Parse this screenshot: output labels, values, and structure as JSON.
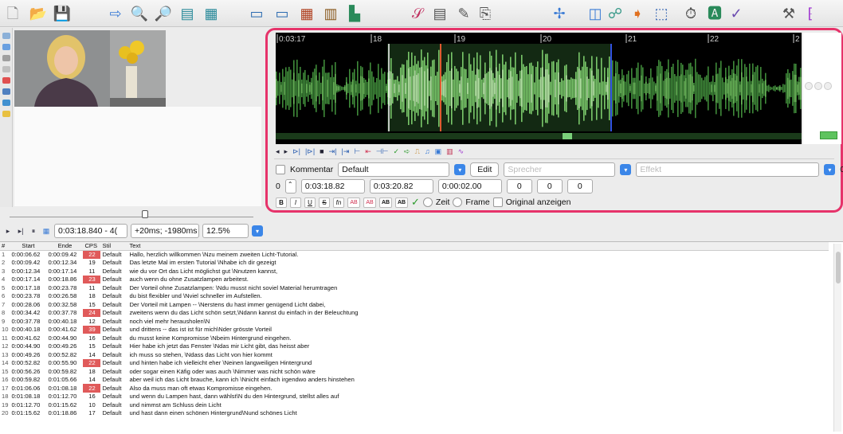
{
  "toolbar": {
    "icons": [
      "new-file-icon",
      "open-folder-icon",
      "save-icon",
      "arrow-right-icon",
      "zoom-in-icon",
      "zoom-out-icon",
      "translate-icon",
      "import-icon",
      "open-video-icon",
      "close-video-icon",
      "grid-icon",
      "film-icon",
      "chart-icon",
      "spell-icon",
      "notepad-icon",
      "sign-icon",
      "pin-icon",
      "waveform-icon",
      "columns-icon",
      "connect-icon",
      "forward-icon",
      "selection-icon",
      "timer-icon",
      "fonts-icon",
      "check-icon",
      "tools-icon",
      "shortcut-icon"
    ]
  },
  "waveform": {
    "ticks": [
      "0:03:17",
      "18",
      "19",
      "20",
      "21",
      "22",
      "2"
    ]
  },
  "editor": {
    "comment_label": "Kommentar",
    "style_value": "Default",
    "edit_label": "Edit",
    "speaker_placeholder": "Sprecher",
    "effect_placeholder": "Effekt",
    "layer": "0",
    "margin_right_value": "0",
    "start": "0:03:18.82",
    "end": "0:03:20.82",
    "duration": "0:00:02.00",
    "margin_l": "0",
    "margin_r": "0",
    "margin_v": "0",
    "fmt": [
      "B",
      "I",
      "U",
      "S",
      "fn"
    ],
    "ab": [
      "AB",
      "AB",
      "AB",
      "AB"
    ],
    "time_label": "Zeit",
    "frame_label": "Frame",
    "original_label": "Original anzeigen"
  },
  "video": {
    "time": "0:03:18.840 - 4(",
    "offset": "+20ms; -1980ms",
    "zoom": "12.5%"
  },
  "grid": {
    "headers": [
      "#",
      "Start",
      "Ende",
      "CPS",
      "Stil",
      "Text"
    ],
    "rows": [
      {
        "n": "1",
        "start": "0:00:06.62",
        "end": "0:00:09.42",
        "cps": "22",
        "hot": true,
        "stil": "Default",
        "text": "Hallo, herzlich willkommen \\Nzu meinem zweiten Licht-Tutorial."
      },
      {
        "n": "2",
        "start": "0:00:09.42",
        "end": "0:00:12.34",
        "cps": "19",
        "hot": false,
        "stil": "Default",
        "text": "Das letzte Mal im ersten Tutorial \\Nhabe ich dir gezeigt"
      },
      {
        "n": "3",
        "start": "0:00:12.34",
        "end": "0:00:17.14",
        "cps": "11",
        "hot": false,
        "stil": "Default",
        "text": "wie du vor Ort das Licht möglichst gut \\Nnutzen kannst,"
      },
      {
        "n": "4",
        "start": "0:00:17.14",
        "end": "0:00:18.86",
        "cps": "23",
        "hot": true,
        "stil": "Default",
        "text": "auch wenn du ohne Zusatzlampen arbeitest."
      },
      {
        "n": "5",
        "start": "0:00:17.18",
        "end": "0:00:23.78",
        "cps": "11",
        "hot": false,
        "stil": "Default",
        "text": "Der Vorteil ohne Zusatzlampen: \\Ndu musst nicht soviel Material herumtragen"
      },
      {
        "n": "6",
        "start": "0:00:23.78",
        "end": "0:00:26.58",
        "cps": "18",
        "hot": false,
        "stil": "Default",
        "text": "du bist flexibler und \\Nviel schneller im Aufstellen."
      },
      {
        "n": "7",
        "start": "0:00:28.06",
        "end": "0:00:32.58",
        "cps": "15",
        "hot": false,
        "stil": "Default",
        "text": "Der Vorteil mit Lampen -- \\Nerstens du hast immer genügend Licht dabei,"
      },
      {
        "n": "8",
        "start": "0:00:34.42",
        "end": "0:00:37.78",
        "cps": "24",
        "hot": true,
        "stil": "Default",
        "text": "zweitens wenn du das Licht schön setzt,\\Ndann kannst du einfach in der Beleuchtung"
      },
      {
        "n": "9",
        "start": "0:00:37.78",
        "end": "0:00:40.18",
        "cps": "12",
        "hot": false,
        "stil": "Default",
        "text": " noch viel mehr herausholen\\N"
      },
      {
        "n": "10",
        "start": "0:00:40.18",
        "end": "0:00:41.62",
        "cps": "39",
        "hot": true,
        "stil": "Default",
        "text": "und drittens -- das ist ist für mich\\Nder grösste Vorteil"
      },
      {
        "n": "11",
        "start": "0:00:41.62",
        "end": "0:00:44.90",
        "cps": "16",
        "hot": false,
        "stil": "Default",
        "text": "du musst keine Kompromisse \\Nbeim Hintergrund eingehen."
      },
      {
        "n": "12",
        "start": "0:00:44.90",
        "end": "0:00:49.26",
        "cps": "15",
        "hot": false,
        "stil": "Default",
        "text": "Hier habe ich jetzt das Fenster \\Ndas mir Licht gibt, das heisst aber"
      },
      {
        "n": "13",
        "start": "0:00:49.26",
        "end": "0:00:52.82",
        "cps": "14",
        "hot": false,
        "stil": "Default",
        "text": "ich muss so stehen, \\Ndass das Licht von hier kommt"
      },
      {
        "n": "14",
        "start": "0:00:52.82",
        "end": "0:00:55.90",
        "cps": "22",
        "hot": true,
        "stil": "Default",
        "text": "und hinten habe ich vielleicht eher \\Neinen langweiligen Hintergrund"
      },
      {
        "n": "15",
        "start": "0:00:56.26",
        "end": "0:00:59.82",
        "cps": "18",
        "hot": false,
        "stil": "Default",
        "text": "oder sogar einen Käfig oder was auch \\Nimmer was nicht schön wäre"
      },
      {
        "n": "16",
        "start": "0:00:59.82",
        "end": "0:01:05.66",
        "cps": "14",
        "hot": false,
        "stil": "Default",
        "text": "aber weil ich das Licht brauche, kann ich \\Nnicht einfach irgendwo anders hinstehen"
      },
      {
        "n": "17",
        "start": "0:01:06.06",
        "end": "0:01:08.18",
        "cps": "22",
        "hot": true,
        "stil": "Default",
        "text": "Also da muss man oft etwas Kompromisse eingehen."
      },
      {
        "n": "18",
        "start": "0:01:08.18",
        "end": "0:01:12.70",
        "cps": "16",
        "hot": false,
        "stil": "Default",
        "text": "und wenn du Lampen hast, dann wählst\\N du den Hintergrund, stellst alles auf"
      },
      {
        "n": "19",
        "start": "0:01:12.70",
        "end": "0:01:15.62",
        "cps": "10",
        "hot": false,
        "stil": "Default",
        "text": "und nimmst am Schluss dein Licht"
      },
      {
        "n": "20",
        "start": "0:01:15.62",
        "end": "0:01:18.86",
        "cps": "17",
        "hot": false,
        "stil": "Default",
        "text": "und hast dann einen schönen Hintergrund\\Nund schönes Licht"
      }
    ]
  }
}
